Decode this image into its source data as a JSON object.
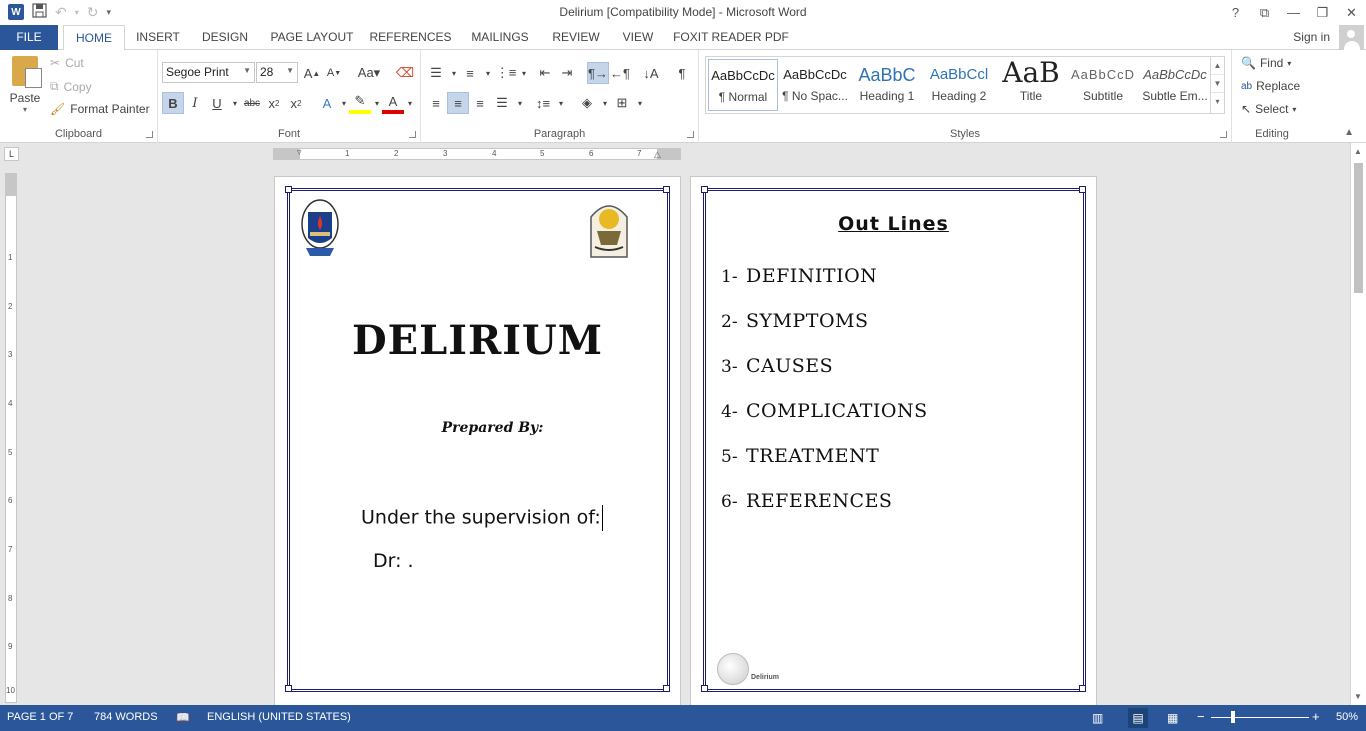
{
  "window": {
    "title": "Delirium [Compatibility Mode] - Microsoft Word",
    "app_icon": "W",
    "controls": [
      "?",
      "⧉",
      "—",
      "❐",
      "✕"
    ]
  },
  "ribbon_tabs": {
    "file": "FILE",
    "home": "HOME",
    "insert": "INSERT",
    "design": "DESIGN",
    "page_layout": "PAGE LAYOUT",
    "references": "REFERENCES",
    "mailings": "MAILINGS",
    "review": "REVIEW",
    "view": "VIEW",
    "foxit": "FOXIT READER PDF",
    "sign_in": "Sign in"
  },
  "clipboard": {
    "paste": "Paste",
    "cut": "Cut",
    "copy": "Copy",
    "format_painter": "Format Painter",
    "group_label": "Clipboard"
  },
  "font": {
    "family": "Segoe Print",
    "size": "28",
    "group_label": "Font"
  },
  "paragraph": {
    "group_label": "Paragraph"
  },
  "styles": {
    "group_label": "Styles",
    "items": [
      {
        "sample": "AaBbCcDc",
        "name": "¶ Normal"
      },
      {
        "sample": "AaBbCcDc",
        "name": "¶ No Spac..."
      },
      {
        "sample": "AaBbC",
        "name": "Heading 1"
      },
      {
        "sample": "AaBbCcl",
        "name": "Heading 2"
      },
      {
        "sample": "AaB",
        "name": "Title"
      },
      {
        "sample": "AaBbCcD",
        "name": "Subtitle"
      },
      {
        "sample": "AaBbCcDc",
        "name": "Subtle Em..."
      }
    ]
  },
  "editing": {
    "find": "Find",
    "replace": "Replace",
    "select": "Select",
    "group_label": "Editing"
  },
  "ruler_numbers": [
    "1",
    "2",
    "3",
    "4",
    "5",
    "6",
    "7"
  ],
  "vruler_numbers": [
    "1",
    "2",
    "3",
    "4",
    "5",
    "6",
    "7",
    "8",
    "9",
    "10"
  ],
  "page1": {
    "title": "DELIRIUM",
    "prepared_by": "Prepared By:",
    "supervision": "Under the supervision of:",
    "doctor": "Dr: ."
  },
  "page2": {
    "title": "Out Lines",
    "items": [
      {
        "num": "1-",
        "text": "DEFINITION"
      },
      {
        "num": "2-",
        "text": "SYMPTOMS"
      },
      {
        "num": "3-",
        "text": "CAUSES"
      },
      {
        "num": "4-",
        "text": "COMPLICATIONS"
      },
      {
        "num": "5-",
        "text": "TREATMENT"
      },
      {
        "num": "6-",
        "text": "REFERENCES"
      }
    ],
    "footer_label": "Delirium"
  },
  "statusbar": {
    "page": "PAGE 1 OF 7",
    "words": "784 WORDS",
    "language": "ENGLISH (UNITED STATES)",
    "zoom": "50%"
  },
  "colors": {
    "accent": "#2b579a",
    "border": "#1d1d6e"
  }
}
